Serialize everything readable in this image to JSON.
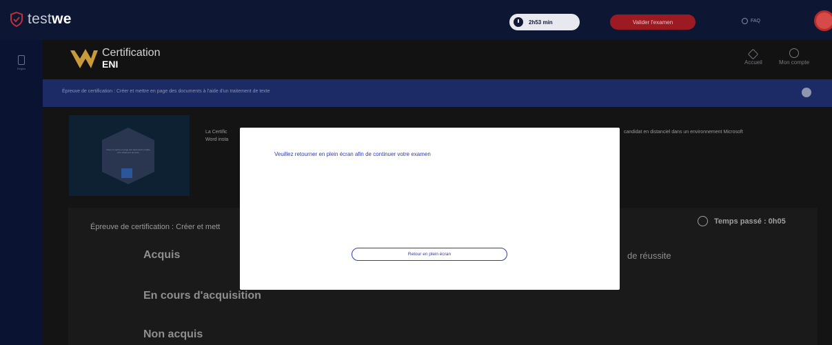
{
  "app": {
    "brand_prefix": "test",
    "brand_suffix": "we",
    "timer": "2h53 min",
    "validate_label": "Valider l'examen",
    "faq_label": "FAQ",
    "accent": "#9c1a22",
    "brand_bg": "#0d1733"
  },
  "rail": {
    "items": [
      {
        "label": "Règles",
        "icon": "rules-icon"
      }
    ]
  },
  "cert": {
    "title": "Certification",
    "subtitle": "ENI",
    "nav": {
      "home_label": "Accueil",
      "account_label": "Mon compte"
    }
  },
  "banner": {
    "text": "Épreuve de certification : Créer et mettre en page des documents à l'aide d'un traitement de texte",
    "color": "#1c2b66"
  },
  "content": {
    "badge_text": "Créer et mettre en page des documents à l'aide d'un traitement de texte",
    "desc_line1": "La Certific",
    "desc_line2": "Word insta",
    "desc_right": "candidat en distanciel dans un environnement Microsoft",
    "results_title": "Épreuve de certification : Créer et mett",
    "time_spent": "Temps passé : 0h05",
    "status_acquis": "Acquis",
    "status_reussite": "de réussite",
    "status_encours": "En cours d'acquisition",
    "status_non": "Non acquis"
  },
  "modal": {
    "message": "Veuillez retourner en plein écran afin de continuer votre examen",
    "button": "Retour en plein écran",
    "accent": "#2c3bb0"
  }
}
